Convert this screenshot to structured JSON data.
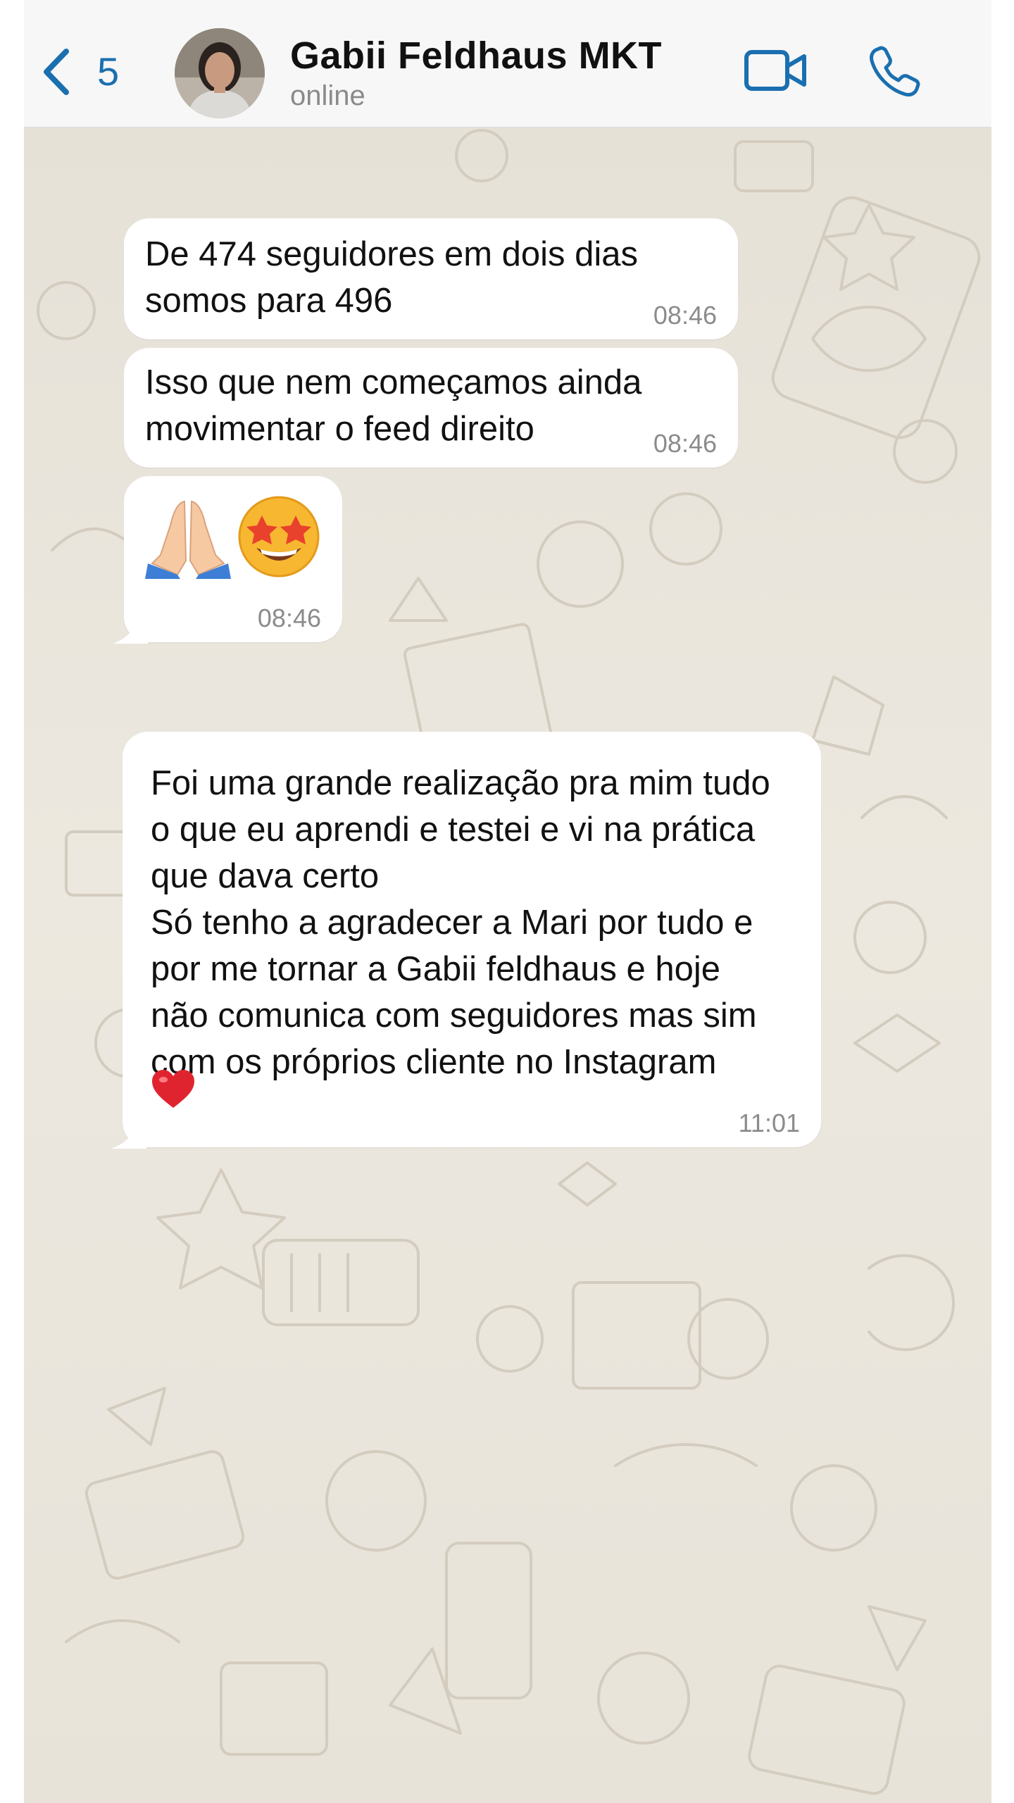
{
  "header": {
    "back_count": "5",
    "contact_name": "Gabii Feldhaus MKT",
    "status": "online",
    "accent_color": "#1a6fb0"
  },
  "messages": [
    {
      "text": "De 474 seguidores em dois dias\nsomos para 496",
      "time": "08:46"
    },
    {
      "text": "Isso que nem começamos ainda\nmovimentar o feed direito",
      "time": "08:46"
    },
    {
      "emoji": [
        "folded-hands",
        "star-struck"
      ],
      "time": "08:46"
    },
    {
      "text": "Foi uma grande realização pra mim tudo\no que eu aprendi e testei e vi na prática\nque dava certo\nSó tenho a agradecer a Mari por tudo e\npor me tornar a Gabii feldhaus e hoje\nnão comunica com seguidores mas sim\ncom os próprios cliente no Instagram",
      "emoji": [
        "red-heart"
      ],
      "time": "11:01"
    }
  ],
  "colors": {
    "bubble": "#ffffff",
    "chat_background": "#e9e4da"
  }
}
